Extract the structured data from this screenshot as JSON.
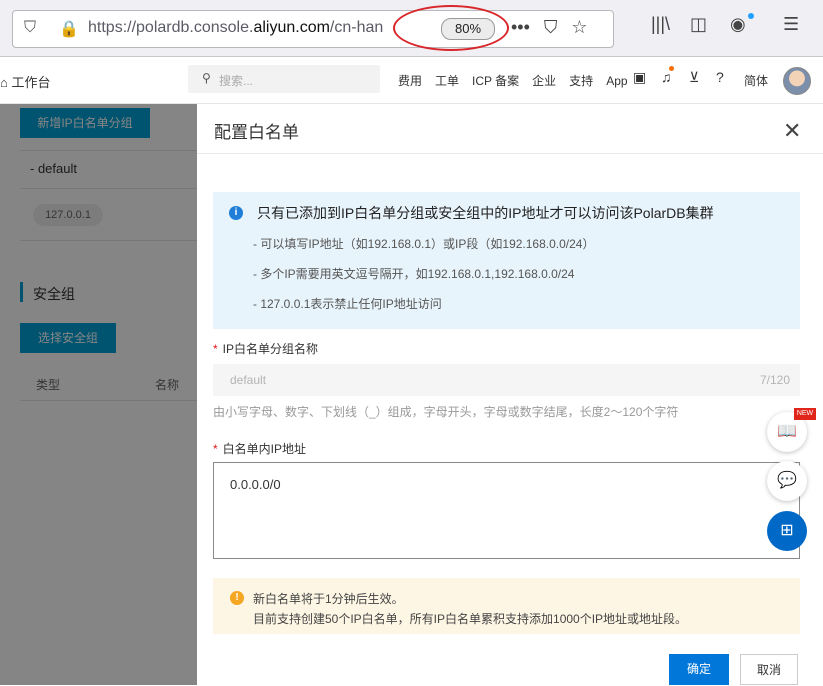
{
  "browser": {
    "url_prefix": "https://polardb.console.",
    "url_domain": "aliyun.com",
    "url_suffix": "/cn-han",
    "zoom": "80%"
  },
  "header": {
    "workbench": "工作台",
    "search_placeholder": "搜索...",
    "nav": [
      "费用",
      "工单",
      "ICP 备案",
      "企业",
      "支持",
      "App"
    ],
    "lang": "简体"
  },
  "left_panel": {
    "add_group_button": "新增IP白名单分组",
    "group_name": "- default",
    "ip_tag": "127.0.0.1",
    "security_group_title": "安全组",
    "select_sg_button": "选择安全组",
    "col_type": "类型",
    "col_name": "名称"
  },
  "dialog": {
    "title": "配置白名单",
    "info_title": "只有已添加到IP白名单分组或安全组中的IP地址才可以访问该PolarDB集群",
    "info_lines": [
      "- 可以填写IP地址（如192.168.0.1）或IP段（如192.168.0.0/24）",
      "- 多个IP需要用英文逗号隔开，如192.168.0.1,192.168.0.0/24",
      "- 127.0.0.1表示禁止任何IP地址访问"
    ],
    "group_name_label": "IP白名单分组名称",
    "group_name_value": "default",
    "group_name_count": "7/120",
    "group_name_hint": "由小写字母、数字、下划线（_）组成，字母开头，字母或数字结尾，长度2～120个字符",
    "ip_list_label": "白名单内IP地址",
    "ip_list_value": "0.0.0.0/0",
    "warn_lines": [
      "新白名单将于1分钟后生效。",
      "目前支持创建50个IP白名单，所有IP白名单累积支持添加1000个IP地址或地址段。"
    ],
    "ok_button": "确定",
    "cancel_button": "取消"
  },
  "floating": {
    "new_tag": "NEW"
  },
  "colors": {
    "primary_blue": "#0077d9",
    "annotation_red": "#d8262b",
    "info_bg": "#e8f4fb",
    "warn_bg": "#fdf6e4"
  }
}
